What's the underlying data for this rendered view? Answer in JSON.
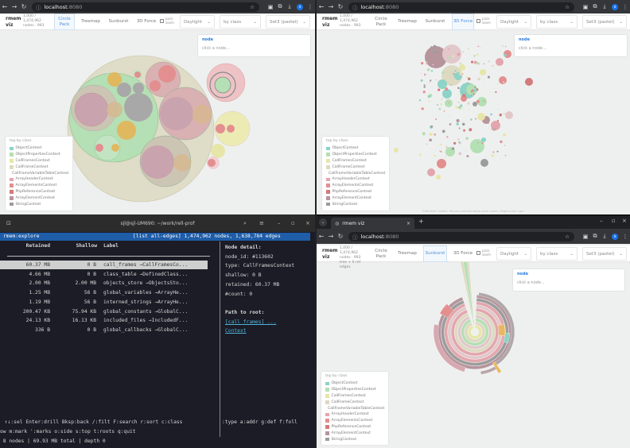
{
  "browser": {
    "url_host": "localhost",
    "url_port": ":8080",
    "avatar": "s"
  },
  "app": {
    "logo": "rmem viz",
    "stats_top": "1,000 / 1,474,962 nodes · 993",
    "stats_bottom": "1,000 / 1,474,962 nodes · 993 tree + 0 ref edges",
    "tabs": [
      "Circle Pack",
      "Treemap",
      "Sunburst",
      "3D Force"
    ],
    "pack_zoom": "pack zoom",
    "theme": "Daylight",
    "color_by": "by class",
    "palette": "Set3 (pastel)",
    "node_title": "node",
    "node_hint": "click a node...",
    "force_hint": "Left-click: rotate, Mouse-wheel/middle-click: zoom, Right-click: pan"
  },
  "tab_title": "rmem viz",
  "legend": {
    "title": "top by class",
    "items": [
      {
        "label": "ObjectContext",
        "color": "#8dd3c7"
      },
      {
        "label": "ObjectPropertiesContext",
        "color": "#b5dfb4"
      },
      {
        "label": "CallFramesContext",
        "color": "#e6e6a8"
      },
      {
        "label": "CallFrameContext",
        "color": "#ddd9c2"
      },
      {
        "label": "CallFrameVariableTableContext",
        "color": "#e2c8cb"
      },
      {
        "label": "ArrayHeaderContext",
        "color": "#e3a6ad"
      },
      {
        "label": "ArrayElementsContext",
        "color": "#e38f8f"
      },
      {
        "label": "PhpReferenceContext",
        "color": "#d27b7b"
      },
      {
        "label": "ArrayElementContext",
        "color": "#b6959d"
      },
      {
        "label": "StringContext",
        "color": "#9c9c9c"
      }
    ]
  },
  "terminal": {
    "title": "sjl@sjl-UM690: ~/work/rell-prof",
    "app": "rmem:explore",
    "summary": "[list all-edges] 1,474,962 nodes, 1,638,784 edges",
    "columns": [
      "Retained",
      "Shallow",
      "Label"
    ],
    "rows": [
      {
        "retained": "60.37 MB",
        "shallow": "0 B",
        "label": "call_frames →CallFramesCo..."
      },
      {
        "retained": "4.66 MB",
        "shallow": "0 B",
        "label": "class_table →DefinedClass..."
      },
      {
        "retained": "2.00 MB",
        "shallow": "2.00 MB",
        "label": "objects_store →ObjectsSto..."
      },
      {
        "retained": "1.25 MB",
        "shallow": "56 B",
        "label": "global_variables →ArrayHe..."
      },
      {
        "retained": "1.19 MB",
        "shallow": "56 B",
        "label": "interned_strings →ArrayHe..."
      },
      {
        "retained": "200.47 KB",
        "shallow": "75.94 KB",
        "label": "global_constants →GlobalC..."
      },
      {
        "retained": "24.13 KB",
        "shallow": "16.13 KB",
        "label": "included_files →IncludedF..."
      },
      {
        "retained": "336 B",
        "shallow": "0 B",
        "label": "global_callbacks →GlobalC..."
      }
    ],
    "detail": {
      "title": "Node detail:",
      "node_id": "node_id: #113602",
      "type": "type: CallFramesContext",
      "shallow": "shallow: 0 B",
      "retained": "retained: 60.37 MB",
      "count": "#count: 0",
      "path_title": "Path to root:",
      "path1": "[call_frames] ...",
      "path2": "Context"
    },
    "help1": " ↑↓:sel Enter:drill Bksp:back /:filt F:search r:sort c:class",
    "help1b": ":type a:addr g:def f:foll",
    "help2": "ow m:mark ':marks o:side s:top t:roots q:quit",
    "status": " 8 nodes | 69.93 MB total | depth 0"
  }
}
